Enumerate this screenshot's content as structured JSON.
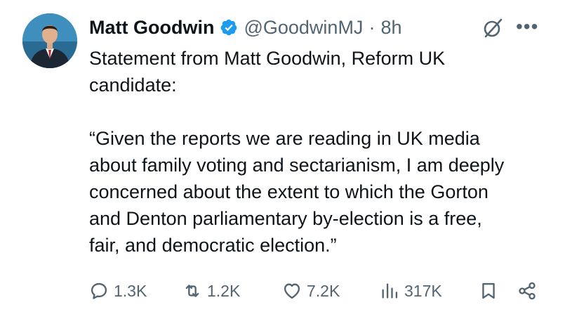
{
  "author": {
    "name": "Matt Goodwin",
    "handle": "@GoodwinMJ",
    "separator": "·",
    "time": "8h"
  },
  "icons": {
    "verified": "verified-badge-icon",
    "grok": "grok-icon",
    "more": "more-icon",
    "reply": "reply-icon",
    "retweet": "retweet-icon",
    "like": "heart-icon",
    "views": "views-icon",
    "bookmark": "bookmark-icon",
    "share": "share-icon"
  },
  "colors": {
    "verified": "#1d9bf0",
    "text": "#0f1419",
    "secondary": "#536471"
  },
  "body": {
    "line1": "Statement from Matt Goodwin, Reform UK",
    "line2": "candidate:",
    "line3": "“Given the reports we are reading in UK media",
    "line4": "about family voting and sectarianism, I am deeply",
    "line5": "concerned about the extent to which the Gorton",
    "line6": "and Denton parliamentary by-election is a free,",
    "line7": "fair, and democratic election.”"
  },
  "stats": {
    "replies": "1.3K",
    "reposts": "1.2K",
    "likes": "7.2K",
    "views": "317K"
  }
}
